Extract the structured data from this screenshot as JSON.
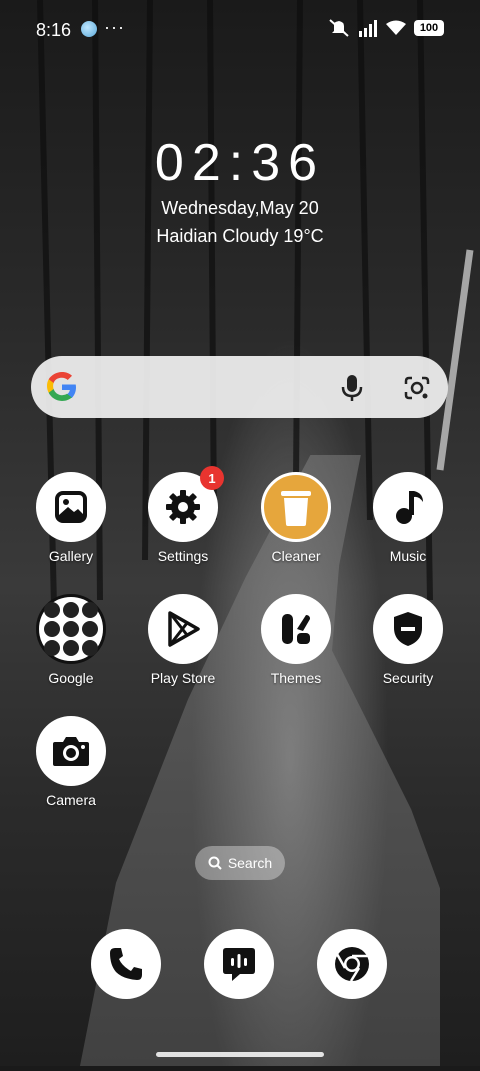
{
  "status_bar": {
    "time": "8:16",
    "overflow": "···",
    "battery": "100",
    "icons": [
      "globe-icon",
      "mute-icon",
      "signal-icon",
      "wifi-icon",
      "battery-icon"
    ]
  },
  "clock": {
    "time": "02:36",
    "date": "Wednesday,May 20",
    "weather": "Haidian Cloudy 19°C"
  },
  "search_bar": {
    "icons": [
      "google-logo-icon",
      "mic-icon",
      "lens-icon"
    ]
  },
  "apps": [
    {
      "label": "Gallery",
      "icon": "gallery-icon"
    },
    {
      "label": "Settings",
      "icon": "gear-icon",
      "badge": "1"
    },
    {
      "label": "Cleaner",
      "icon": "trash-icon"
    },
    {
      "label": "Music",
      "icon": "music-note-icon"
    },
    {
      "label": "Google",
      "icon": "google-folder-icon"
    },
    {
      "label": "Play Store",
      "icon": "play-store-icon"
    },
    {
      "label": "Themes",
      "icon": "themes-icon"
    },
    {
      "label": "Security",
      "icon": "shield-icon"
    },
    {
      "label": "Camera",
      "icon": "camera-icon"
    }
  ],
  "app_search": {
    "label": "Search",
    "icon": "search-icon"
  },
  "dock": [
    {
      "icon": "phone-icon"
    },
    {
      "icon": "messages-icon"
    },
    {
      "icon": "chrome-icon"
    }
  ],
  "colors": {
    "badge": "#e8342f",
    "cleaner": "#e6a63c",
    "search_bar_bg": "#f0f0f0"
  }
}
